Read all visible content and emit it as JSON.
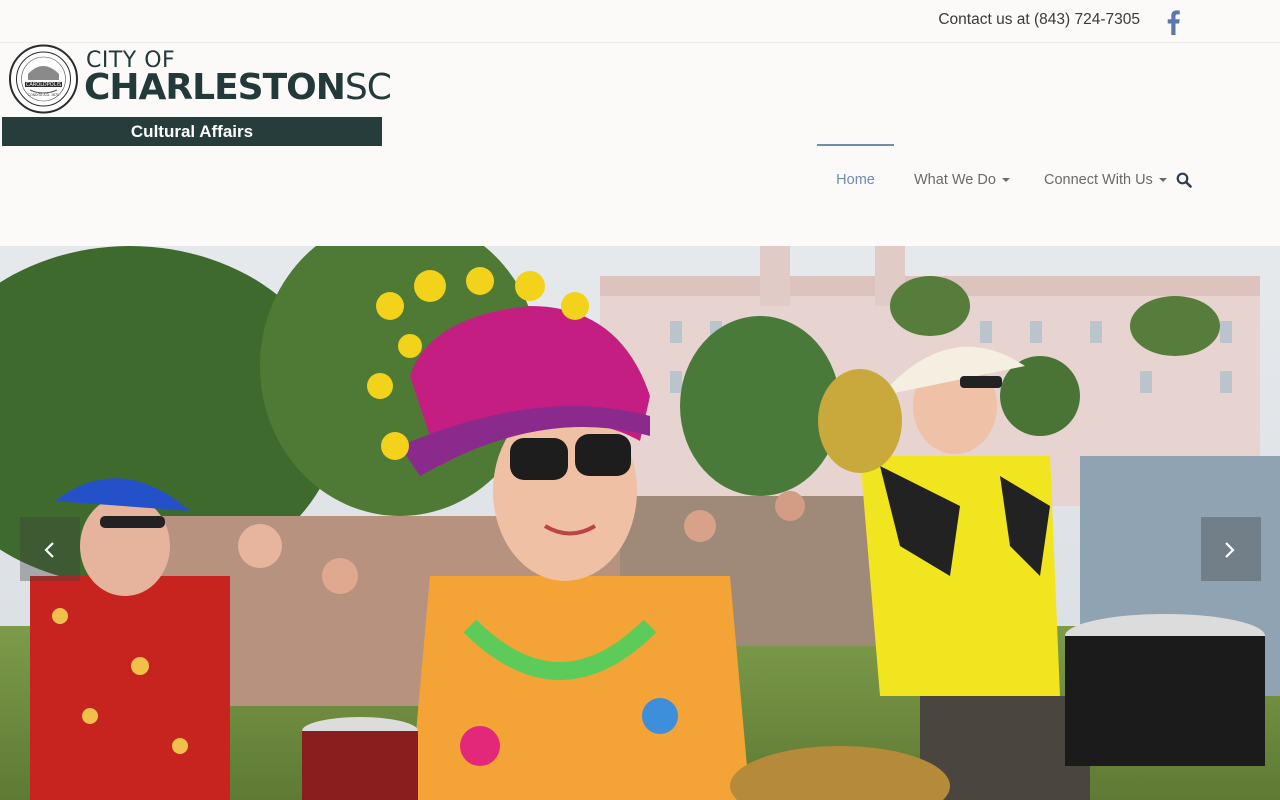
{
  "topbar": {
    "contact_text": "Contact us at (843) 724-7305",
    "facebook_icon": "facebook-icon"
  },
  "logo": {
    "city_of": "CITY OF",
    "charleston": "CHARLESTON",
    "sc": "SC",
    "subtitle": "Cultural Affairs",
    "seal_text": "CAROLOPOLIS",
    "seal_subtext": "CONDITA A.D. 1670",
    "colors": {
      "brand_dark": "#263d3c"
    }
  },
  "nav": {
    "items": [
      {
        "label": "Home",
        "active": true
      },
      {
        "label": "What We Do",
        "dropdown": true
      },
      {
        "label": "Connect With Us",
        "dropdown": true
      }
    ],
    "search_icon": "search-icon",
    "colors": {
      "active": "#6e8db0",
      "default": "#6a6a6a"
    }
  },
  "hero": {
    "image": "festival-parade-photo",
    "prev_icon": "chevron-left-icon",
    "next_icon": "chevron-right-icon"
  }
}
